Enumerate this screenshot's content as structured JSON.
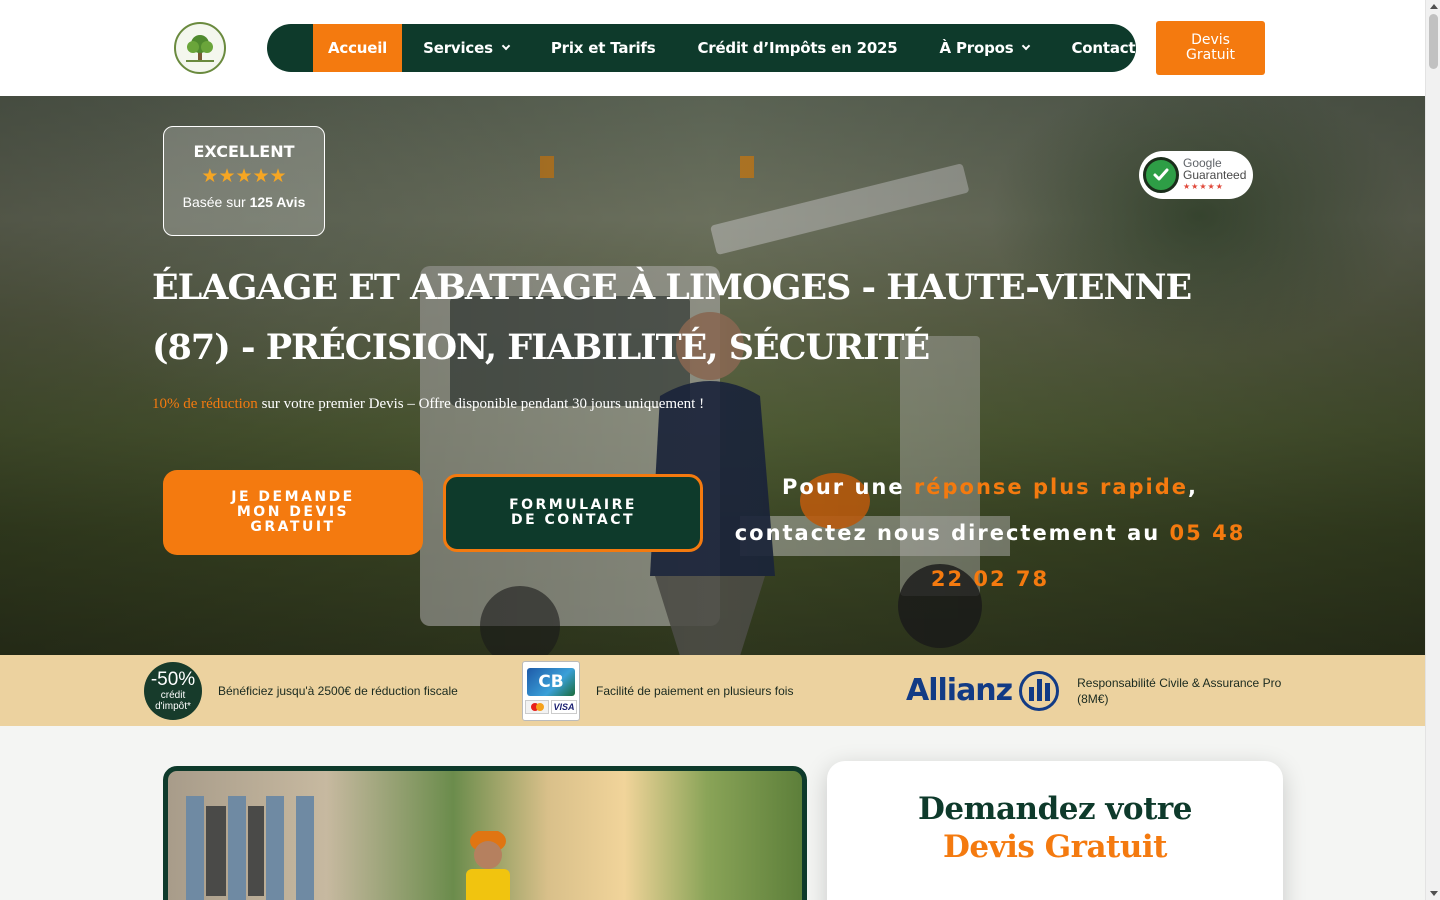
{
  "header": {
    "logo_icon": "logo-tree-icon",
    "nav": [
      {
        "label": "Accueil",
        "active": true,
        "dropdown": false
      },
      {
        "label": "Services",
        "active": false,
        "dropdown": true
      },
      {
        "label": "Prix et Tarifs",
        "active": false,
        "dropdown": false
      },
      {
        "label": "Crédit d’Impôts en 2025",
        "active": false,
        "dropdown": false
      },
      {
        "label": "À Propos",
        "active": false,
        "dropdown": true
      },
      {
        "label": "Contact",
        "active": false,
        "dropdown": false
      }
    ],
    "cta_label": "Devis Gratuit"
  },
  "hero": {
    "rating": {
      "label": "EXCELLENT",
      "stars": "★★★★★",
      "based_prefix": "Basée sur",
      "based_count": "125 Avis"
    },
    "guarantee": {
      "line1": "Google",
      "line2": "Guaranteed",
      "stars": "★★★★★"
    },
    "title": "ÉLAGAGE ET ABATTAGE À LIMOGES - HAUTE-VIENNE (87) - PRÉCISION, FIABILITÉ, SÉCURITÉ",
    "subtitle_highlight": "10% de réduction",
    "subtitle_rest": " sur votre premier Devis – Offre disponible pendant 30 jours uniquement !",
    "cta_primary": "JE DEMANDE MON DEVIS GRATUIT",
    "cta_secondary": "FORMULAIRE DE CONTACT",
    "contact": {
      "part1": "Pour une ",
      "highlight": "réponse plus rapide",
      "part2": ", contactez nous directement au ",
      "phone": "05 48 22 02 78"
    }
  },
  "trust": [
    {
      "badge_big": "-50%",
      "badge_small1": "crédit",
      "badge_small2": "d'impôt*",
      "text": "Bénéficiez jusqu'à 2500€ de réduction fiscale"
    },
    {
      "card_logo": "CB",
      "visa": "VISA",
      "text": "Facilité de paiement en plusieurs fois"
    },
    {
      "brand": "Allianz",
      "text": "Responsabilité Civile & Assurance Pro (8M€)"
    }
  ],
  "quote_card": {
    "line1": "Demandez votre",
    "line2": "Devis Gratuit"
  },
  "colors": {
    "brand_green": "#0e3a2b",
    "accent_orange": "#f47a0f",
    "strip_beige": "#ecd29f"
  }
}
